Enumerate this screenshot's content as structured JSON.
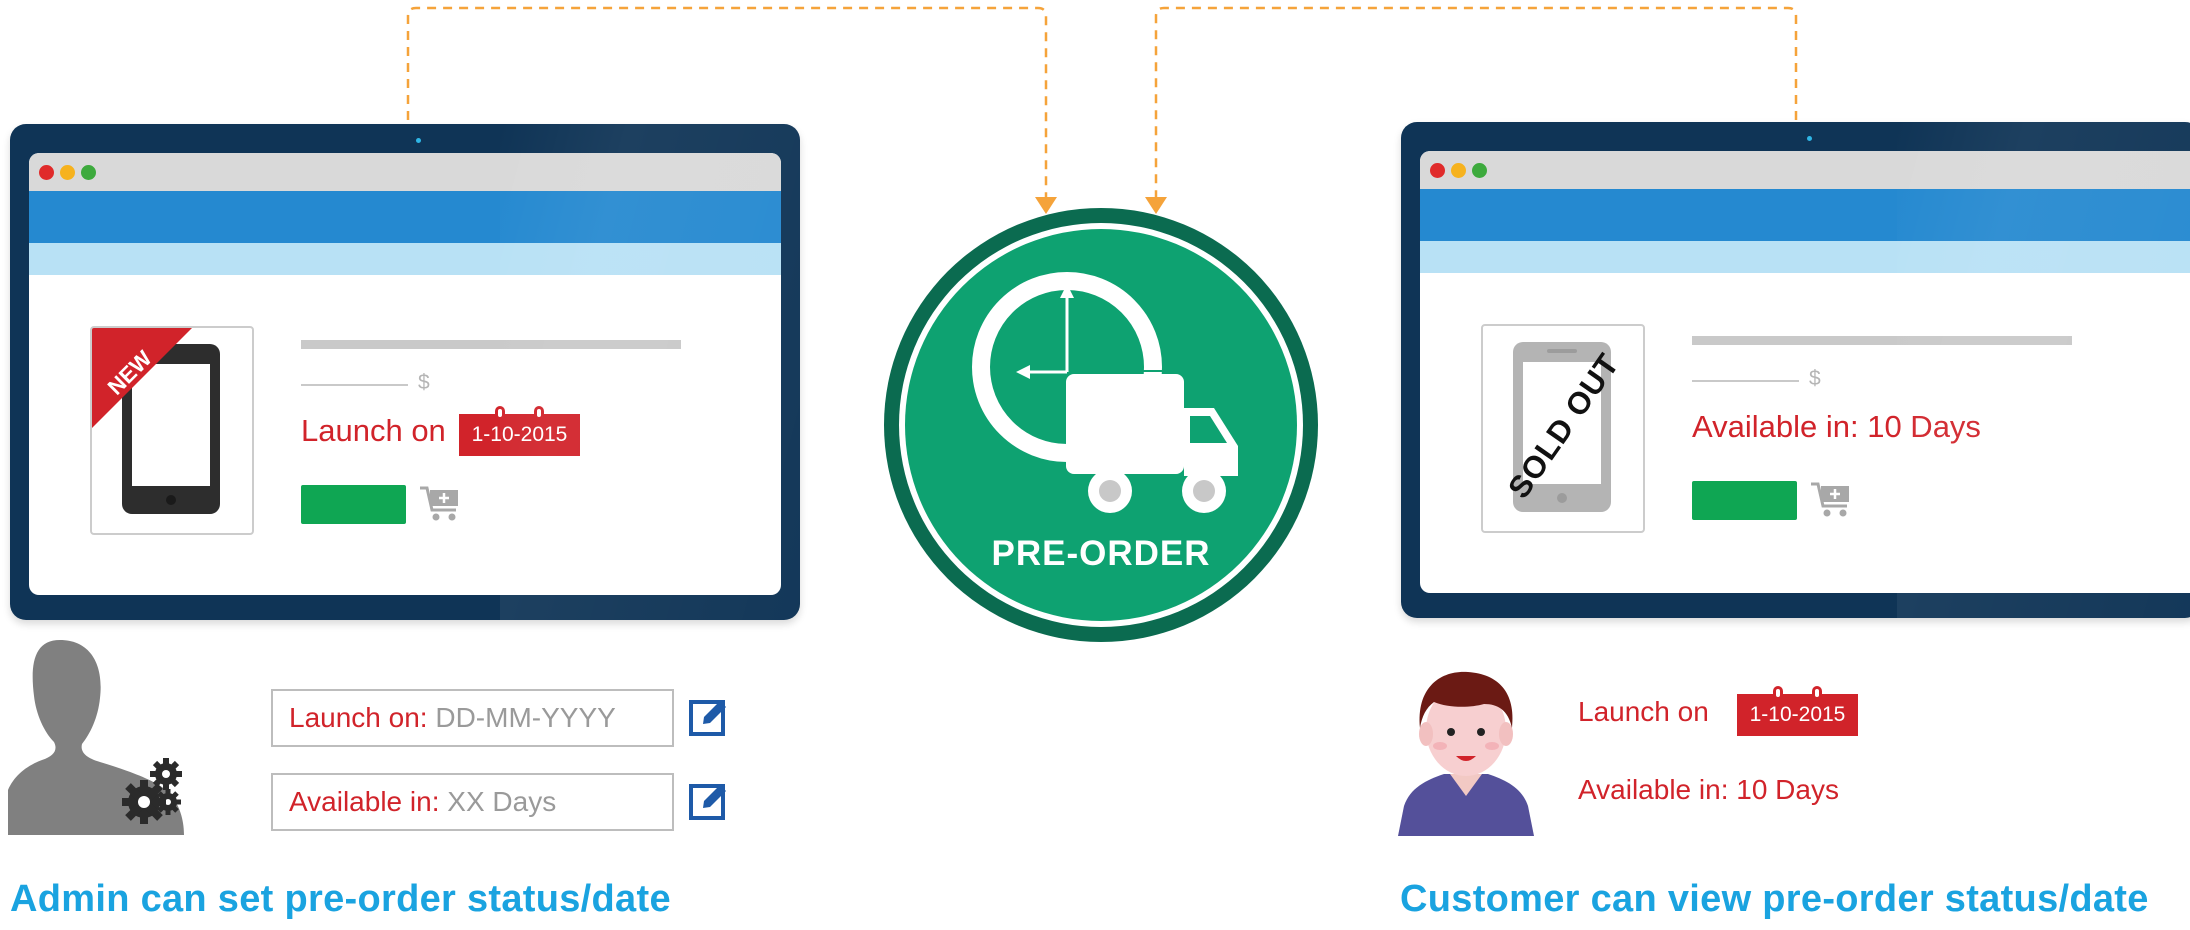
{
  "admin_panel": {
    "badge": "NEW",
    "price_symbol": "$",
    "launch_label": "Launch on",
    "launch_date": "1-10-2015",
    "launch_field": {
      "label": "Launch on:",
      "placeholder": "DD-MM-YYYY"
    },
    "available_field": {
      "label": "Available in:",
      "placeholder": "XX Days"
    },
    "caption": "Admin can set pre-order status/date"
  },
  "center_badge": {
    "label": "PRE-ORDER"
  },
  "customer_panel": {
    "stamp": "SOLD OUT",
    "price_symbol": "$",
    "available_text": "Available in: 10 Days",
    "launch_label": "Launch on",
    "launch_date": "1-10-2015",
    "available_label": "Available in: 10 Days",
    "caption": "Customer can view pre-order status/date"
  },
  "colors": {
    "brand_green": "#0ea271",
    "dark_green": "#0b6b50",
    "accent_red": "#d1232a",
    "caption_blue": "#1aa3e0",
    "connector_orange": "#f5a33a",
    "tablet_navy": "#0f3456"
  },
  "icons": [
    "gear-icon",
    "edit-icon",
    "cart-add-icon",
    "clock-icon",
    "delivery-truck-icon",
    "admin-user-icon",
    "customer-avatar-icon",
    "phone-icon",
    "tablet-icon"
  ]
}
